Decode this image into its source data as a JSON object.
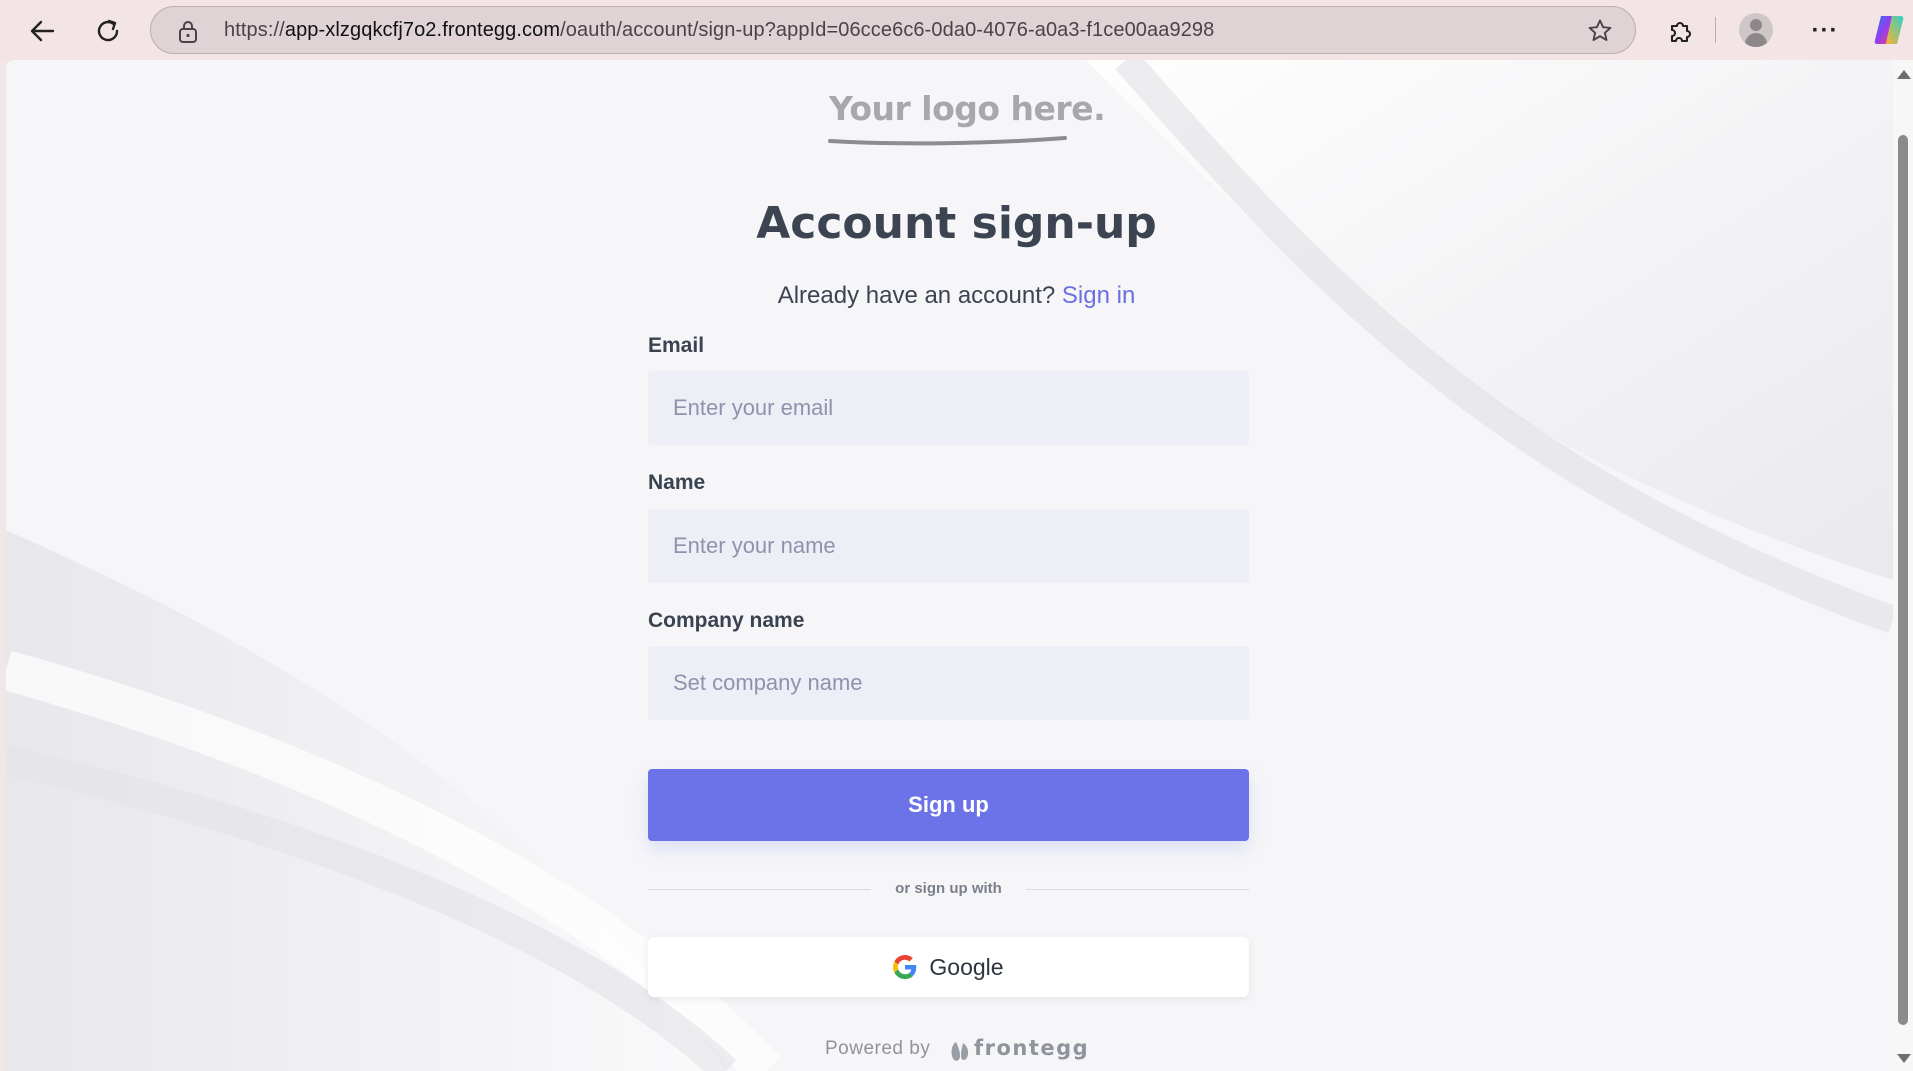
{
  "browser": {
    "url_prefix": "https://",
    "url_host": "app-xlzgqkcfj7o2.frontegg.com",
    "url_path": "/oauth/account/sign-up?appId=06cce6c6-0da0-4076-a0a3-f1ce00aa9298",
    "more_label": "···"
  },
  "page": {
    "logo_text": "Your logo here.",
    "title": "Account sign-up",
    "subtitle": "Already have an account?",
    "signin_link": "Sign in"
  },
  "form": {
    "email": {
      "label": "Email",
      "placeholder": "Enter your email",
      "value": ""
    },
    "name": {
      "label": "Name",
      "placeholder": "Enter your name",
      "value": ""
    },
    "company": {
      "label": "Company name",
      "placeholder": "Set company name",
      "value": ""
    },
    "submit_label": "Sign up"
  },
  "social": {
    "divider_text": "or sign up with",
    "google_label": "Google"
  },
  "footer": {
    "powered_by": "Powered by",
    "brand": "frontegg"
  },
  "colors": {
    "accent": "#6c72e8",
    "link": "#6b6fe0",
    "heading": "#3c4452",
    "field_bg": "#eeeef7"
  },
  "icons": [
    "back-arrow-icon",
    "refresh-icon",
    "site-info-lock-icon",
    "favorite-star-icon",
    "extensions-puzzle-icon",
    "profile-avatar-icon",
    "more-options-icon",
    "copilot-icon",
    "google-g-icon",
    "frontegg-logo-icon"
  ]
}
